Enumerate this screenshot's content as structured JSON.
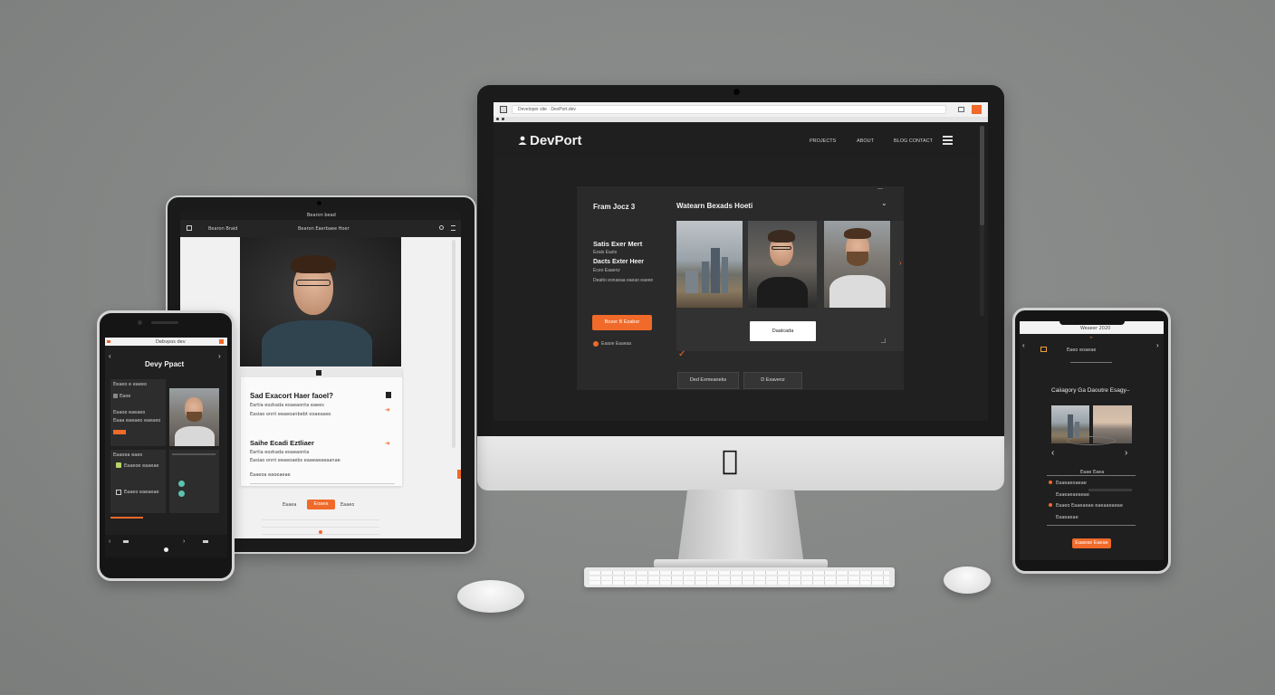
{
  "imac": {
    "url": "Developer site · DevPort.dev",
    "brand": "DevPort",
    "nav": [
      "PROJECTS",
      "ABOUT",
      "BLOG CONTACT"
    ],
    "hero_left_title": "Fram Jocz 3",
    "hero_gallery_title": "Watearn Bexads Hoeti",
    "hero_h1": "Satis Exer Mert",
    "hero_h1_sub": "Ezals Eazts",
    "hero_h2": "Dacts Exter Heer",
    "hero_h2_sub": "Eceo Eaaenz",
    "hero_line": "Deatto eonaeaa eaeao eaeee",
    "cta_primary": "Bozer B Ezabor",
    "cta_note": "Eaaoe Eaaeaa",
    "gallery_button": "Daatcada",
    "footer_btn_1": "Ded Exmeaneks",
    "footer_btn_2": "D Exavenz"
  },
  "ipad": {
    "status": "Bearon bead",
    "nav_left": "Bearon Braid",
    "nav_center": "Bearon Eaerbaee Hoer",
    "card_title_1": "Sad Exacort Haer faoel?",
    "card_sub_1": "Eartia eozkada eoaeaonta eaees",
    "card_sub_1b": "Easiao onnt eeaeoanbebt ooaeaaes",
    "card_title_2": "Saihe Ecadi Eztliaer",
    "card_sub_2": "Eartia eozkada eoaeaonta",
    "card_sub_2b": "Easiao onnt eeaeoaebs eaaeaeaeaanae",
    "card_note": "Eaaeoa eaoeaeae",
    "tab_left": "Eaaea",
    "tab_active": "Eoaea",
    "tab_right": "Eaaeo"
  },
  "phone_left": {
    "url": "Debvpos dev",
    "brand": "Devy Ppact",
    "card1_title": "Eeaeo e eaeeo",
    "card1_label": "Eaoe",
    "card1_line1": "Eaaoe eaeaeo",
    "card1_line2": "Eaaa eaeaeo eaeaeo",
    "card2_title": "Eaaoea eaeo",
    "card2_label": "Eaaeoe eaaeae",
    "card2_line": "Eaaeo eaeaeae"
  },
  "phone_right": {
    "url": "Weaeer 2020",
    "breadcrumb": "Eaeo eoaeae",
    "headline": "Caiiagory Ga Daoutre Esagy–",
    "section_label": "Eaae Eaea",
    "item1": "Eaaeaeoaeae",
    "item2": "Eaaeaeaeaeae",
    "item3": "Eaaeo Eaaeaeae eaeaaeaeae",
    "item4": "Eaaeaeae",
    "cta": "Eaaeae Eaeae"
  },
  "colors": {
    "accent": "#f06a2a",
    "screen_bg": "#202020",
    "card_bg": "#2a2a2a"
  }
}
